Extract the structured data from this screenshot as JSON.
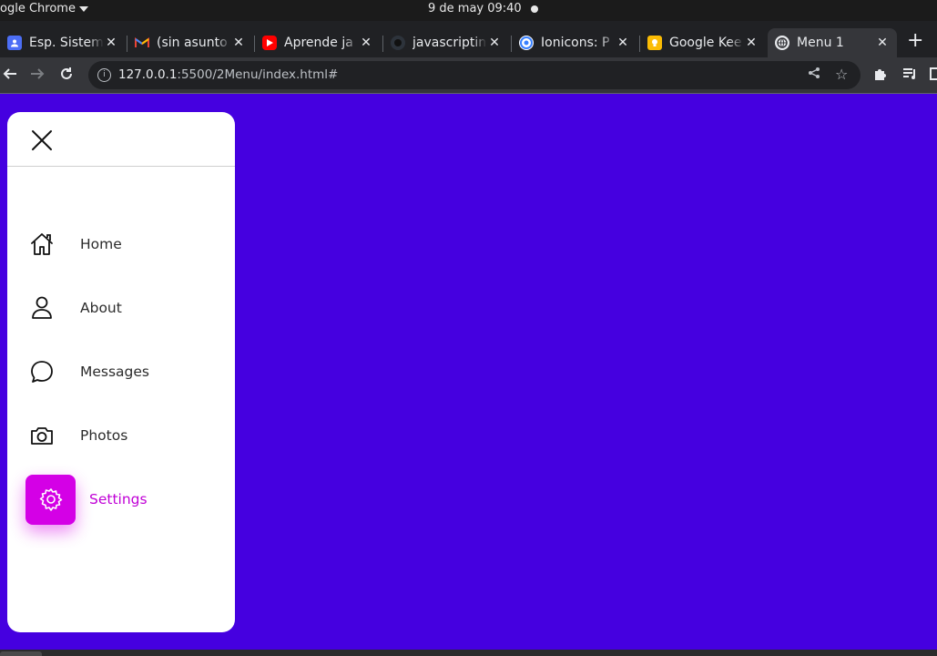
{
  "os": {
    "app_name": "ogle Chrome",
    "clock": "9 de may  09:40"
  },
  "browser": {
    "tabs": [
      {
        "title": "Esp. Sistem",
        "favicon": "contact-card-icon",
        "color": "#4c6ef5"
      },
      {
        "title": "(sin asunto",
        "favicon": "gmail-icon",
        "color": "#ea4335"
      },
      {
        "title": "Aprende ja",
        "favicon": "youtube-icon",
        "color": "#ff0000"
      },
      {
        "title": "javascriptin",
        "favicon": "github-icon",
        "color": "#2d333b"
      },
      {
        "title": "Ionicons: P",
        "favicon": "ionicons-icon",
        "color": "#3880ff"
      },
      {
        "title": "Google Kee",
        "favicon": "google-keep-icon",
        "color": "#fbbc04"
      },
      {
        "title": "Menu 1",
        "favicon": "globe-icon",
        "color": "#e8eaed",
        "active": true
      }
    ],
    "url_host": "127.0.0.1",
    "url_path": ":5500/2Menu/index.html#"
  },
  "page": {
    "background": "#4500e0",
    "accent": "#d400e6",
    "menu": {
      "items": [
        {
          "label": "Home",
          "icon": "home-icon"
        },
        {
          "label": "About",
          "icon": "person-icon"
        },
        {
          "label": "Messages",
          "icon": "chat-bubble-icon"
        },
        {
          "label": "Photos",
          "icon": "camera-icon"
        },
        {
          "label": "Settings",
          "icon": "gear-icon",
          "active": true
        }
      ]
    }
  }
}
